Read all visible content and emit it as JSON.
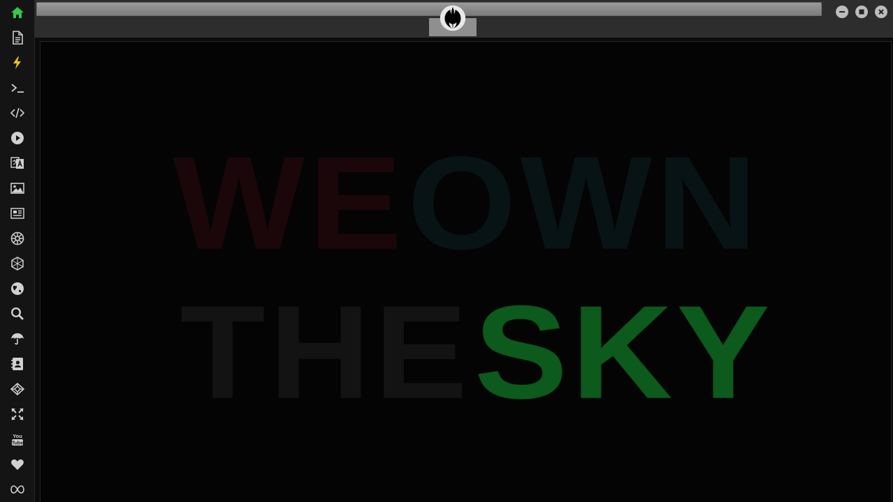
{
  "sidebar": {
    "items": [
      {
        "name": "home",
        "label": "Home",
        "icon": "home-icon",
        "color": "#35c84a"
      },
      {
        "name": "document",
        "label": "Document",
        "icon": "document-icon",
        "color": "#d0d0d0"
      },
      {
        "name": "bolt",
        "label": "Bolt",
        "icon": "bolt-icon",
        "color": "#f0c419"
      },
      {
        "name": "terminal",
        "label": "Terminal",
        "icon": "terminal-icon",
        "color": "#d0d0d0"
      },
      {
        "name": "code",
        "label": "Code",
        "icon": "code-icon",
        "color": "#d0d0d0"
      },
      {
        "name": "play",
        "label": "Play",
        "icon": "play-icon",
        "color": "#d0d0d0"
      },
      {
        "name": "translate",
        "label": "Translate",
        "icon": "translate-icon",
        "color": "#d0d0d0"
      },
      {
        "name": "image",
        "label": "Image",
        "icon": "image-icon",
        "color": "#d0d0d0"
      },
      {
        "name": "news",
        "label": "News",
        "icon": "newspaper-icon",
        "color": "#d0d0d0"
      },
      {
        "name": "empire",
        "label": "Empire",
        "icon": "empire-icon",
        "color": "#d0d0d0"
      },
      {
        "name": "hexagon",
        "label": "Hexagon",
        "icon": "hexagon-icon",
        "color": "#d0d0d0"
      },
      {
        "name": "globe",
        "label": "Globe",
        "icon": "globe-icon",
        "color": "#d0d0d0"
      },
      {
        "name": "search",
        "label": "Search",
        "icon": "search-icon",
        "color": "#d0d0d0"
      },
      {
        "name": "umbrella",
        "label": "Umbrella",
        "icon": "umbrella-icon",
        "color": "#d0d0d0"
      },
      {
        "name": "contacts",
        "label": "Contacts",
        "icon": "address-book-icon",
        "color": "#d0d0d0"
      },
      {
        "name": "codepen",
        "label": "Codepen",
        "icon": "codepen-icon",
        "color": "#d0d0d0"
      },
      {
        "name": "expand",
        "label": "Expand",
        "icon": "expand-icon",
        "color": "#d0d0d0"
      },
      {
        "name": "youtube",
        "label": "YouTube",
        "icon": "youtube-icon",
        "color": "#d0d0d0"
      },
      {
        "name": "heart",
        "label": "Heart",
        "icon": "heart-icon",
        "color": "#d0d0d0"
      },
      {
        "name": "infinity",
        "label": "Infinity",
        "icon": "infinity-icon",
        "color": "#d0d0d0"
      }
    ]
  },
  "topbar": {
    "address_value": "",
    "emblem_icon": "rebel-alliance-icon",
    "controls": [
      {
        "name": "minimize",
        "icon": "minimize-icon"
      },
      {
        "name": "maximize",
        "icon": "maximize-icon"
      },
      {
        "name": "close",
        "icon": "close-icon"
      }
    ]
  },
  "headline": {
    "line1": {
      "word1": "WE",
      "word2": "OWN"
    },
    "line2": {
      "word1": "THE",
      "word2": "SKY"
    }
  },
  "colors": {
    "accent_green": "#35c84a",
    "sky_green": "#0c5a1c",
    "we_red": "#1b070a",
    "own_teal": "#081316"
  }
}
